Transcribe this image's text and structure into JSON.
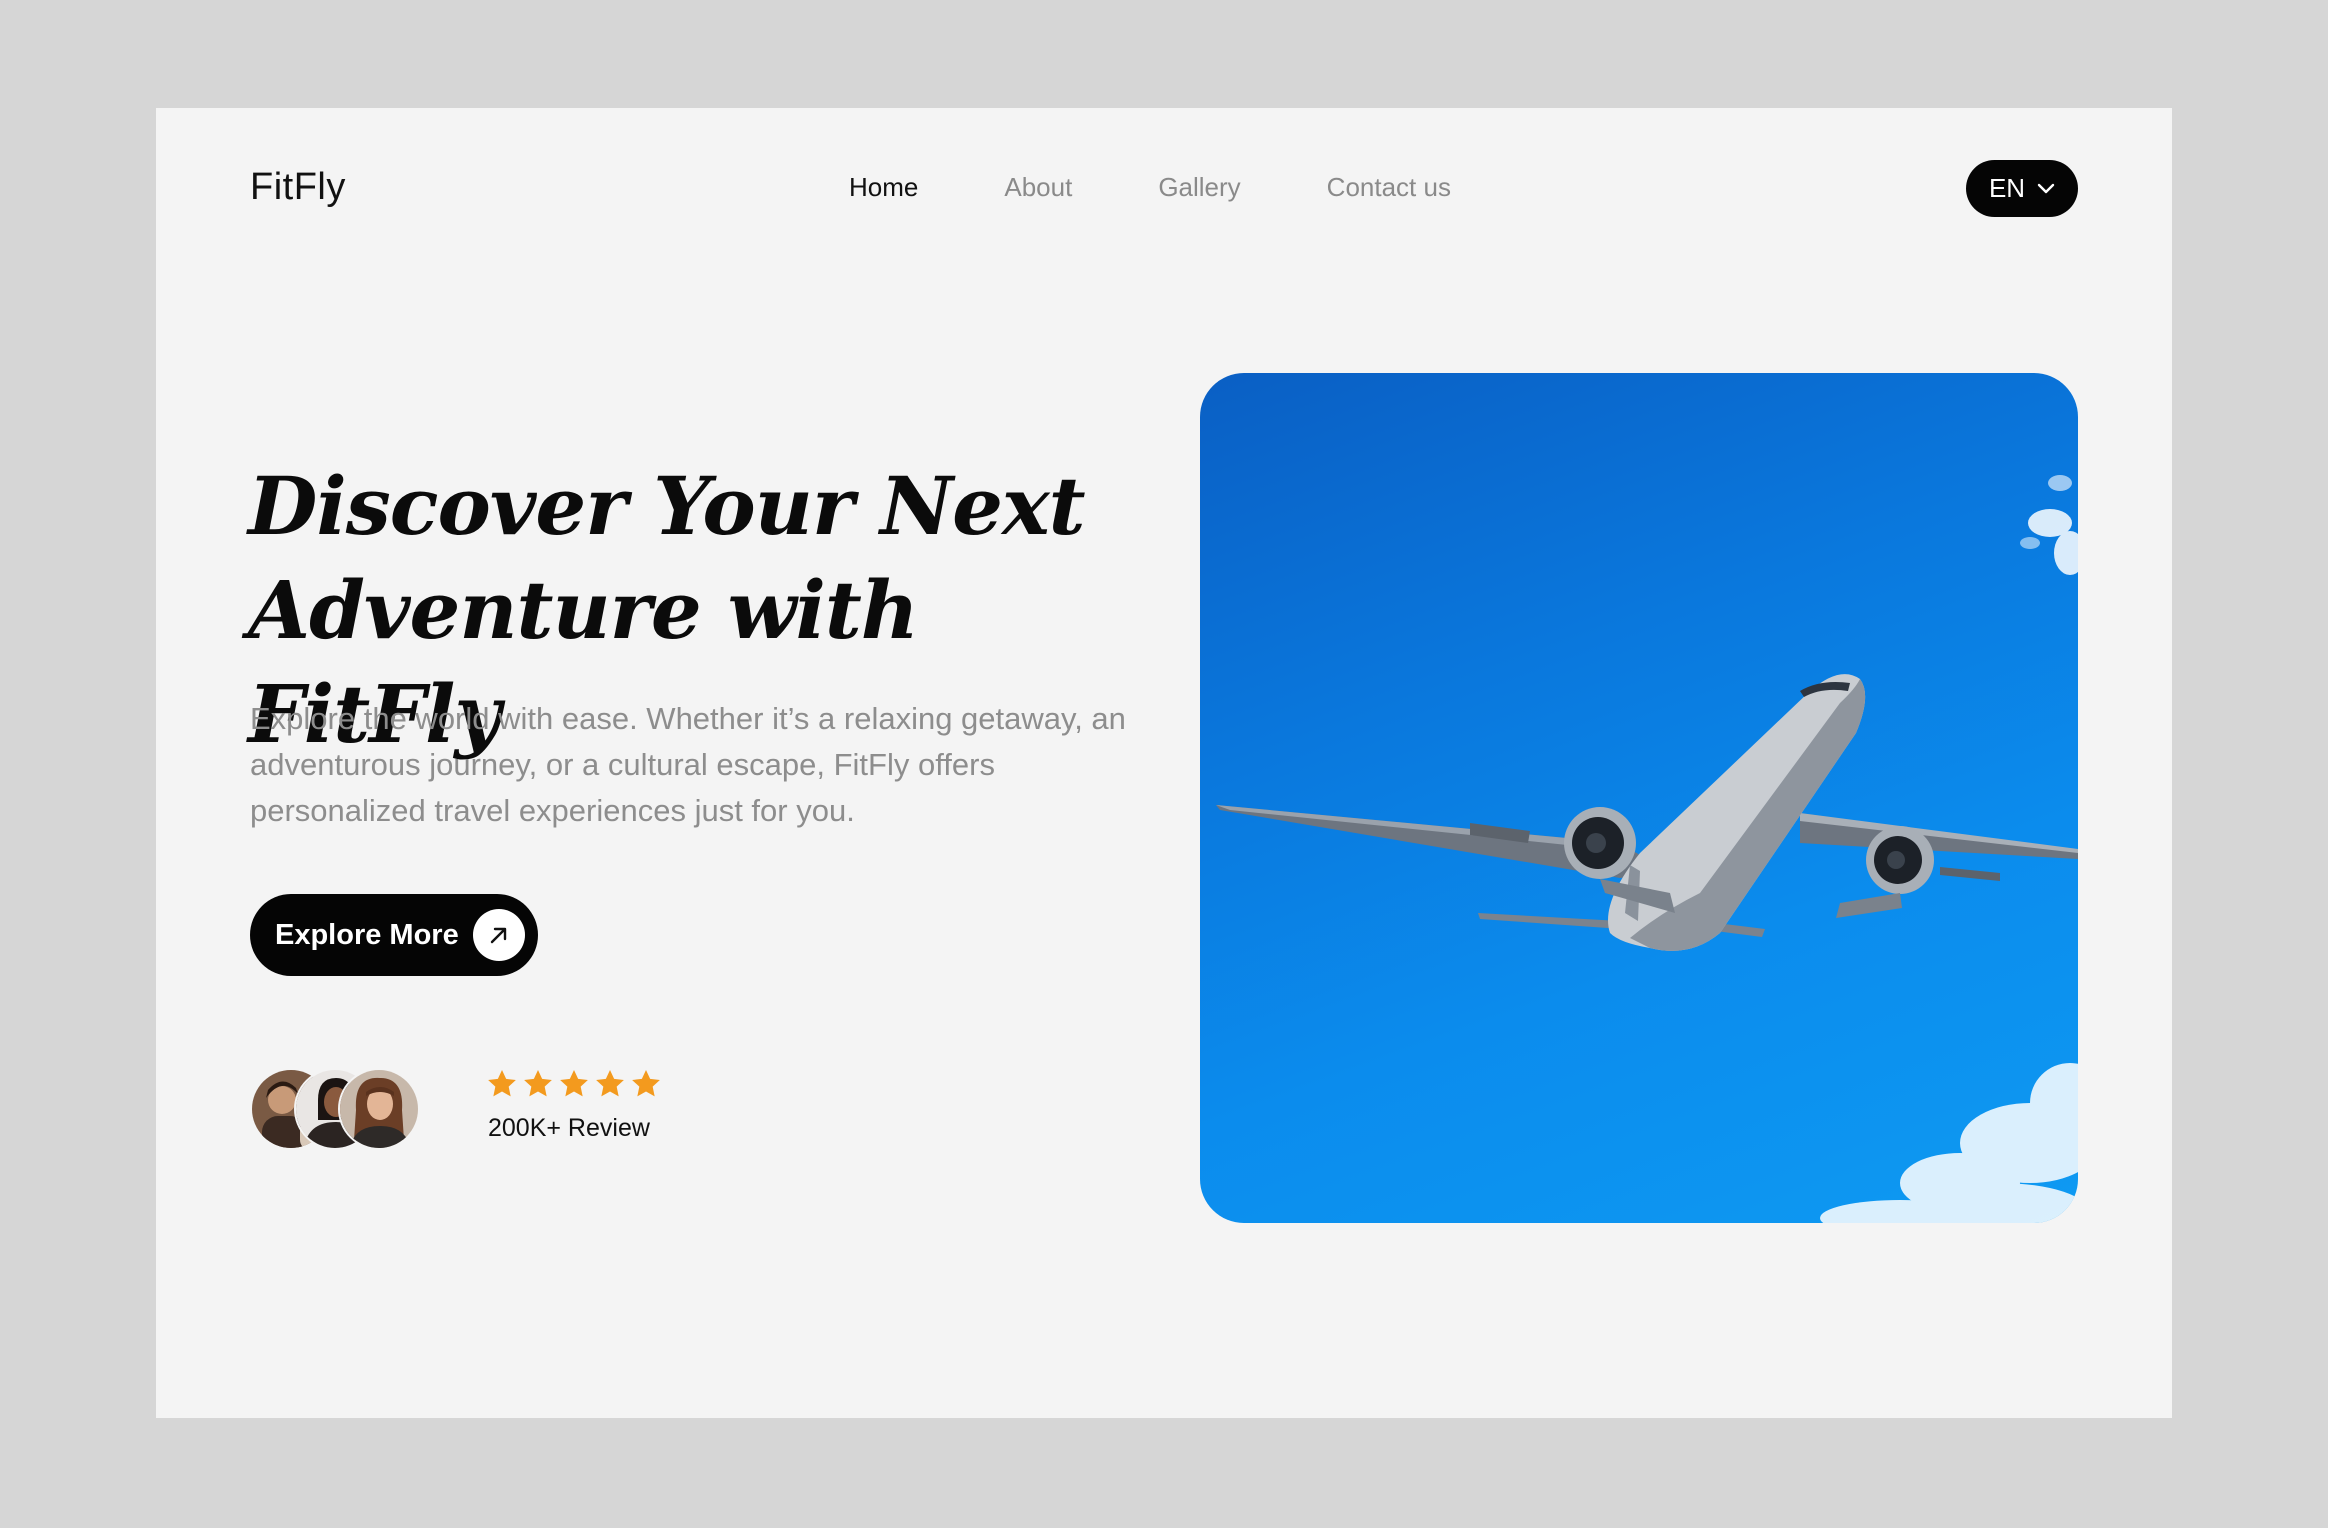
{
  "header": {
    "logo": "FitFly",
    "nav": [
      {
        "label": "Home",
        "active": true
      },
      {
        "label": "About",
        "active": false
      },
      {
        "label": "Gallery",
        "active": false
      },
      {
        "label": "Contact us",
        "active": false
      }
    ],
    "language": "EN"
  },
  "hero": {
    "headline_line1": "Discover Your Next",
    "headline_line2": "Adventure with FitFly",
    "description": "Explore the world with ease. Whether it’s a relaxing getaway, an adventurous journey, or a cultural escape, FitFly offers personalized travel experiences just for you.",
    "cta_label": "Explore More",
    "image_icon": "airplane-photo"
  },
  "reviews": {
    "rating_stars": 5,
    "label": "200K+ Review",
    "avatar_count": 3
  },
  "colors": {
    "accent": "#050505",
    "star": "#f39a1e",
    "page_bg": "#f4f4f4",
    "outer_bg": "#d6d6d6",
    "sky": "#0b8ced"
  }
}
